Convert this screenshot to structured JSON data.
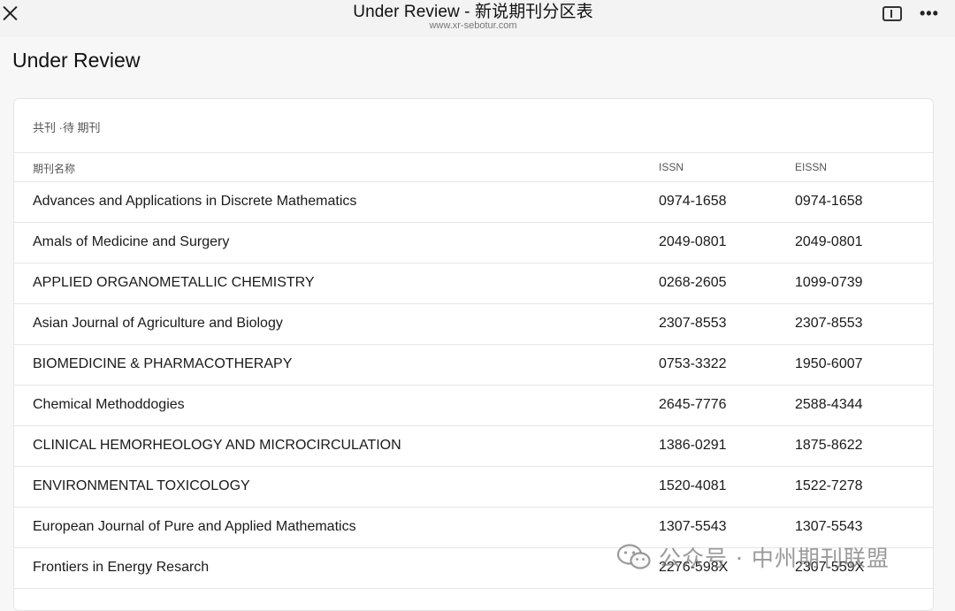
{
  "window": {
    "title": "Under Review - 新说期刊分区表",
    "url": "www.xr-sebotur.com",
    "close_icon": "close-icon",
    "reader_icon": "reader-mode-icon",
    "more_icon": "more-icon",
    "more_glyph": "•••"
  },
  "page": {
    "title": "Under Review"
  },
  "table": {
    "label": "共刊 ·待 期刊",
    "headers": {
      "name": "期刊名称",
      "issn": "ISSN",
      "eissn": "EISSN"
    },
    "rows": [
      {
        "name": "Advances and Applications in Discrete Mathematics",
        "issn": "0974-1658",
        "eissn": "0974-1658"
      },
      {
        "name": "Amals of Medicine and Surgery",
        "issn": "2049-0801",
        "eissn": "2049-0801"
      },
      {
        "name": "APPLIED ORGANOMETALLIC CHEMISTRY",
        "issn": "0268-2605",
        "eissn": "1099-0739"
      },
      {
        "name": "Asian Journal of Agriculture and Biology",
        "issn": "2307-8553",
        "eissn": "2307-8553"
      },
      {
        "name": "BIOMEDICINE & PHARMACOTHERAPY",
        "issn": "0753-3322",
        "eissn": "1950-6007"
      },
      {
        "name": "Chemical Methoddogies",
        "issn": "2645-7776",
        "eissn": "2588-4344"
      },
      {
        "name": "CLINICAL HEMORHEOLOGY AND MICROCIRCULATION",
        "issn": "1386-0291",
        "eissn": "1875-8622"
      },
      {
        "name": "ENVIRONMENTAL TOXICOLOGY",
        "issn": "1520-4081",
        "eissn": "1522-7278"
      },
      {
        "name": "European Journal of Pure and Applied Mathematics",
        "issn": "1307-5543",
        "eissn": "1307-5543"
      },
      {
        "name": "Frontiers in Energy Resarch",
        "issn": "2276-598X",
        "eissn": "2307-559X"
      }
    ]
  },
  "watermark": {
    "icon": "wechat-icon",
    "text": "公众号 · 中州期刊联盟"
  }
}
